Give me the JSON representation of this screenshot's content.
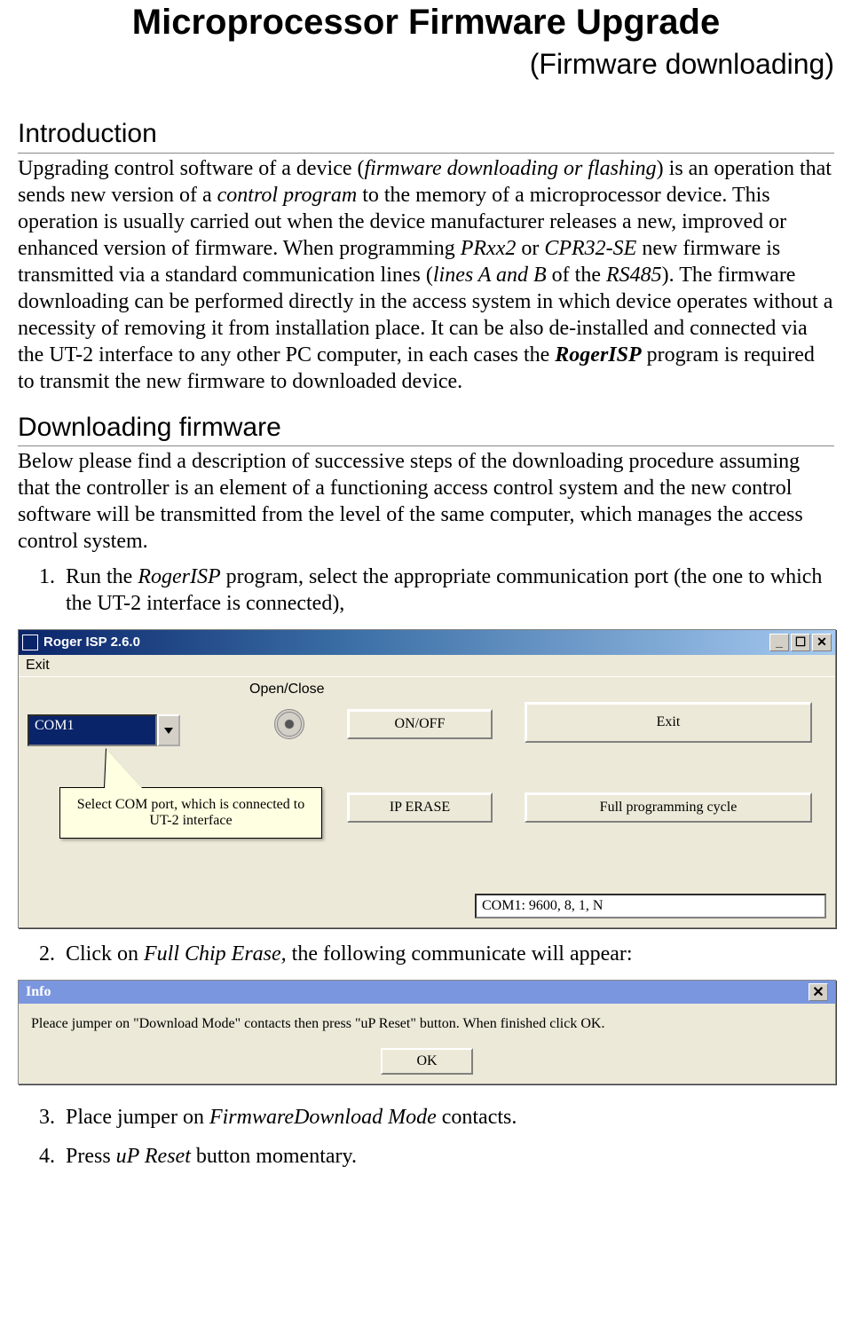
{
  "doc": {
    "title": "Microprocessor Firmware Upgrade",
    "subtitle": "(Firmware downloading)"
  },
  "sections": {
    "intro_heading": "Introduction",
    "intro_html": "Upgrading control software of a device (<span class=\"it\">firmware downloading or flashing</span>) is an operation that sends new version of a <span class=\"it\">control program</span> to the memory of a microprocessor device. This operation is usually carried out when the device manufacturer releases a new, improved or enhanced version of firmware. When programming <span class=\"it\">PRxx2</span> or <span class=\"it\">CPR32-SE</span> new firmware is transmitted via a standard communication lines (<span class=\"it\">lines A and B</span> of the <span class=\"it\">RS485</span>). The firmware downloading can be performed directly in the access system in which device operates without a necessity of removing it from installation place. It can be also de-installed and connected via the UT-2 interface to any other PC computer, in each cases the <span class=\"bi\">RogerISP</span> program is required to transmit the new firmware to downloaded device.",
    "download_heading": "Downloading firmware",
    "download_html": "Below please find a description of successive steps of the downloading procedure assuming that the controller is an element of a functioning access control system and the new control software will be transmitted from the level of the same computer, which manages the access control system."
  },
  "steps": {
    "s1_html": "Run the <span class=\"it\">RogerISP</span> program, select the appropriate communication port (the one to which the UT-2 interface is connected),",
    "s2_html": "Click on <span class=\"it\">Full Chip Erase,</span> the following communicate will appear:",
    "s3_html": "Place jumper on <span class=\"it\">FirmwareDownload Mode</span> contacts.",
    "s4_html": "Press <span class=\"it\">uP Reset</span> button momentary."
  },
  "app": {
    "title": "Roger ISP 2.6.0",
    "menu_exit": "Exit",
    "group_openclose": "Open/Close",
    "combo_value": "COM1",
    "btn_onoff": "ON/OFF",
    "btn_exit": "Exit",
    "btn_perase": "IP ERASE",
    "btn_fullcycle": "Full programming cycle",
    "callout": "Select COM port, which is connected to UT-2 interface",
    "status": "COM1: 9600, 8, 1, N",
    "winbtn_min": "_",
    "winbtn_max": "☐",
    "winbtn_close": "✕"
  },
  "dlg": {
    "title": "Info",
    "body": "Pleace jumper on \"Download Mode\" contacts then press \"uP Reset\" button. When finished click OK.",
    "ok": "OK",
    "close": "✕"
  }
}
